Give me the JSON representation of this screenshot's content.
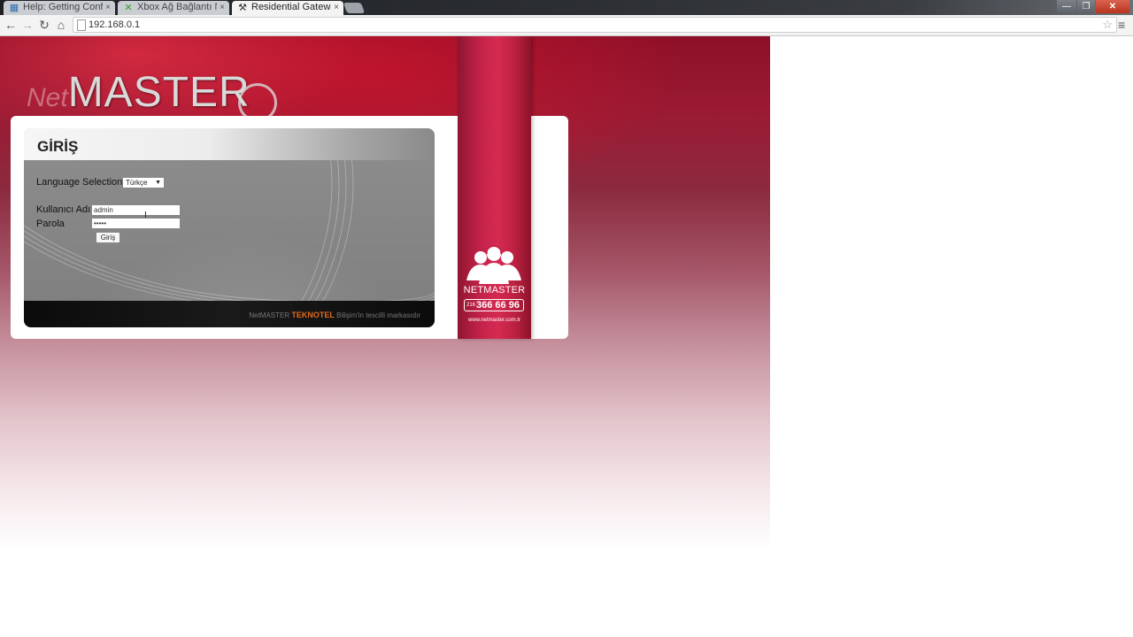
{
  "browser": {
    "tabs": [
      {
        "title": "Help: Getting Config",
        "favicon": "help-page-icon",
        "active": false
      },
      {
        "title": "Xbox Ağ Bağlantı Nc",
        "favicon": "xbox-icon",
        "active": false
      },
      {
        "title": "Residential Gateway",
        "favicon": "tools-icon",
        "active": true
      }
    ],
    "tab_close_glyph": "×",
    "url": "192.168.0.1",
    "window_controls": {
      "minimize": "—",
      "maximize": "❐",
      "close": "✕"
    }
  },
  "page": {
    "logo": {
      "prefix": "Net",
      "main": "MASTE",
      "ring_letter": "R"
    },
    "login": {
      "title": "GİRİŞ",
      "language_label": "Language Selection",
      "language_value": "Türkçe",
      "username_label": "Kullanıcı Adı",
      "username_value": "admin",
      "password_label": "Parola",
      "password_value": "•••••",
      "submit_label": "Giriş"
    },
    "footer": {
      "prefix": "NetMASTER",
      "brand": "TEKNOTEL",
      "suffix": "Bilişim'in tescilli markasıdır"
    },
    "ribbon": {
      "brand": "NETMASTER",
      "phone_prefix": "216",
      "phone_number": "366 66 96",
      "url": "www.netmaster.com.tr"
    }
  },
  "colors": {
    "ribbon": "#c22248",
    "footer_brand": "#e06b1e",
    "page_top": "#8e1028"
  }
}
